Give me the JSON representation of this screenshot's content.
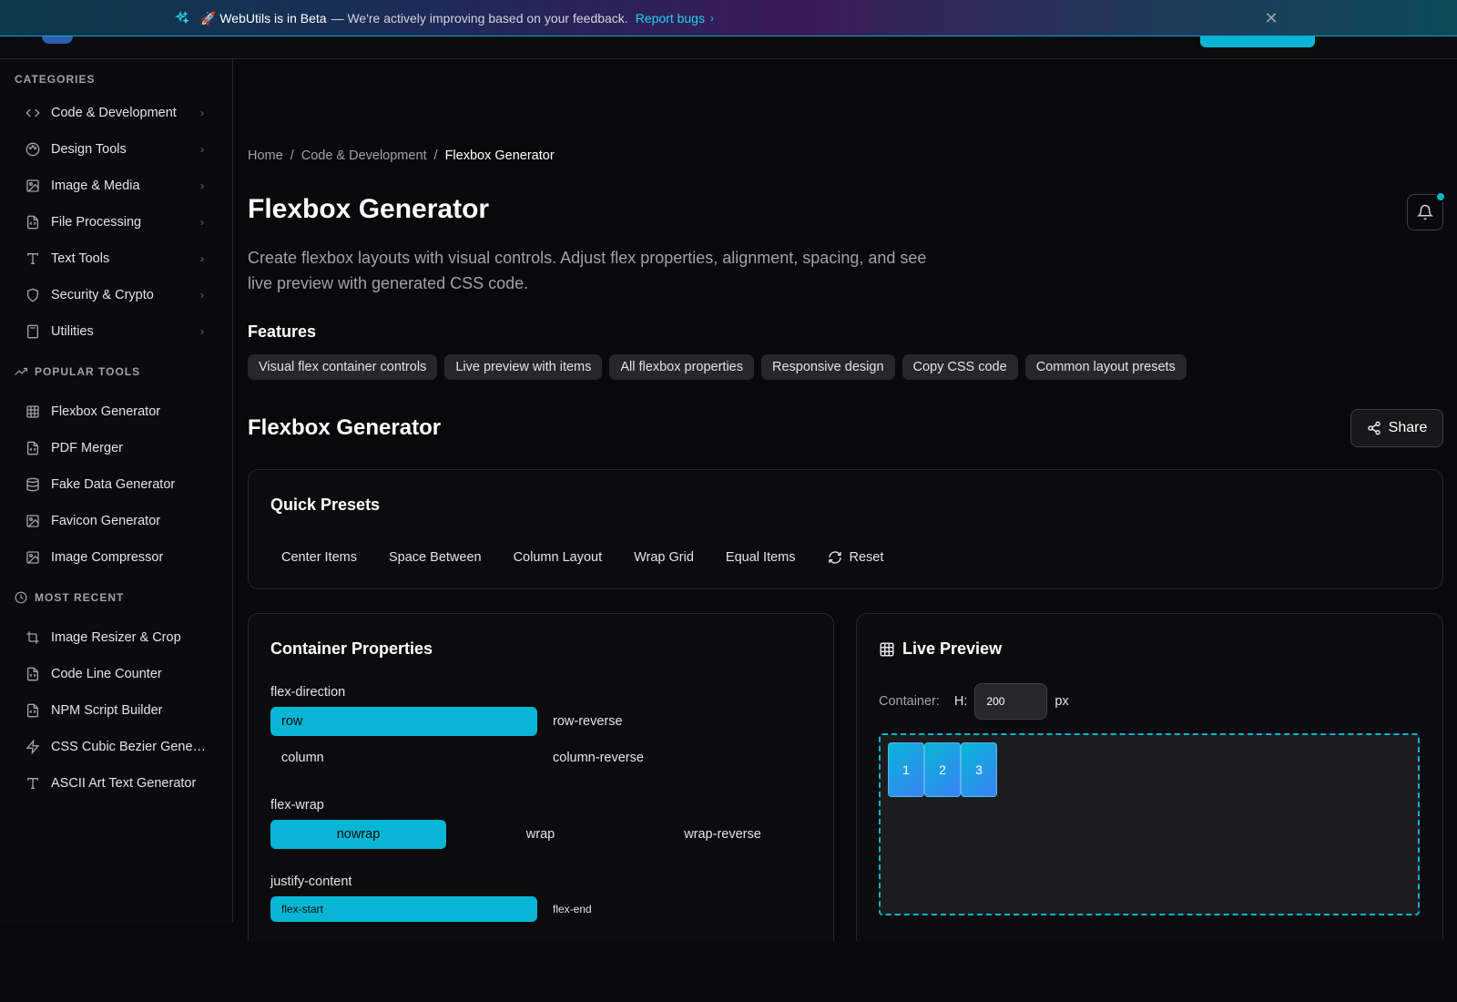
{
  "banner": {
    "title": "🚀 WebUtils is in Beta",
    "message": "— We're actively improving based on your feedback.",
    "link_label": "Report bugs",
    "close_label": "✕"
  },
  "sidebar": {
    "categories_title": "CATEGORIES",
    "categories": [
      {
        "label": "Code & Development",
        "icon": "code-icon"
      },
      {
        "label": "Design Tools",
        "icon": "palette-icon"
      },
      {
        "label": "Image & Media",
        "icon": "image-icon"
      },
      {
        "label": "File Processing",
        "icon": "file-code-icon"
      },
      {
        "label": "Text Tools",
        "icon": "type-icon"
      },
      {
        "label": "Security & Crypto",
        "icon": "shield-icon"
      },
      {
        "label": "Utilities",
        "icon": "calculator-icon"
      }
    ],
    "popular_title": "POPULAR TOOLS",
    "popular": [
      {
        "label": "Flexbox Generator",
        "icon": "grid-icon"
      },
      {
        "label": "PDF Merger",
        "icon": "file-code-icon"
      },
      {
        "label": "Fake Data Generator",
        "icon": "database-icon"
      },
      {
        "label": "Favicon Generator",
        "icon": "image-icon"
      },
      {
        "label": "Image Compressor",
        "icon": "image-icon"
      }
    ],
    "recent_title": "MOST RECENT",
    "recent": [
      {
        "label": "Image Resizer & Crop",
        "icon": "crop-icon"
      },
      {
        "label": "Code Line Counter",
        "icon": "file-code-icon"
      },
      {
        "label": "NPM Script Builder",
        "icon": "file-code-icon"
      },
      {
        "label": "CSS Cubic Bezier Generator",
        "icon": "zap-icon"
      },
      {
        "label": "ASCII Art Text Generator",
        "icon": "type-icon"
      }
    ]
  },
  "breadcrumb": {
    "home": "Home",
    "category": "Code & Development",
    "current": "Flexbox Generator",
    "separator": "/"
  },
  "page": {
    "title": "Flexbox Generator",
    "description": "Create flexbox layouts with visual controls. Adjust flex properties, alignment, spacing, and see live preview with generated CSS code.",
    "features_title": "Features",
    "features": [
      "Visual flex container controls",
      "Live preview with items",
      "All flexbox properties",
      "Responsive design",
      "Copy CSS code",
      "Common layout presets"
    ]
  },
  "tool": {
    "title": "Flexbox Generator",
    "share_label": "Share"
  },
  "presets": {
    "title": "Quick Presets",
    "items": [
      "Center Items",
      "Space Between",
      "Column Layout",
      "Wrap Grid",
      "Equal Items"
    ],
    "reset_label": "Reset"
  },
  "container": {
    "title": "Container Properties",
    "flex_direction": {
      "label": "flex-direction",
      "options": [
        "row",
        "row-reverse",
        "column",
        "column-reverse"
      ],
      "selected": "row"
    },
    "flex_wrap": {
      "label": "flex-wrap",
      "options": [
        "nowrap",
        "wrap",
        "wrap-reverse"
      ],
      "selected": "nowrap"
    },
    "justify_content": {
      "label": "justify-content",
      "options": [
        "flex-start",
        "flex-end"
      ],
      "selected": "flex-start"
    }
  },
  "preview": {
    "title": "Live Preview",
    "container_label": "Container:",
    "height_label": "H:",
    "height_value": "200",
    "unit": "px",
    "items": [
      "1",
      "2",
      "3"
    ]
  },
  "colors": {
    "accent": "#06b6d4",
    "background": "#09090b",
    "card": "#0c0c0e"
  }
}
